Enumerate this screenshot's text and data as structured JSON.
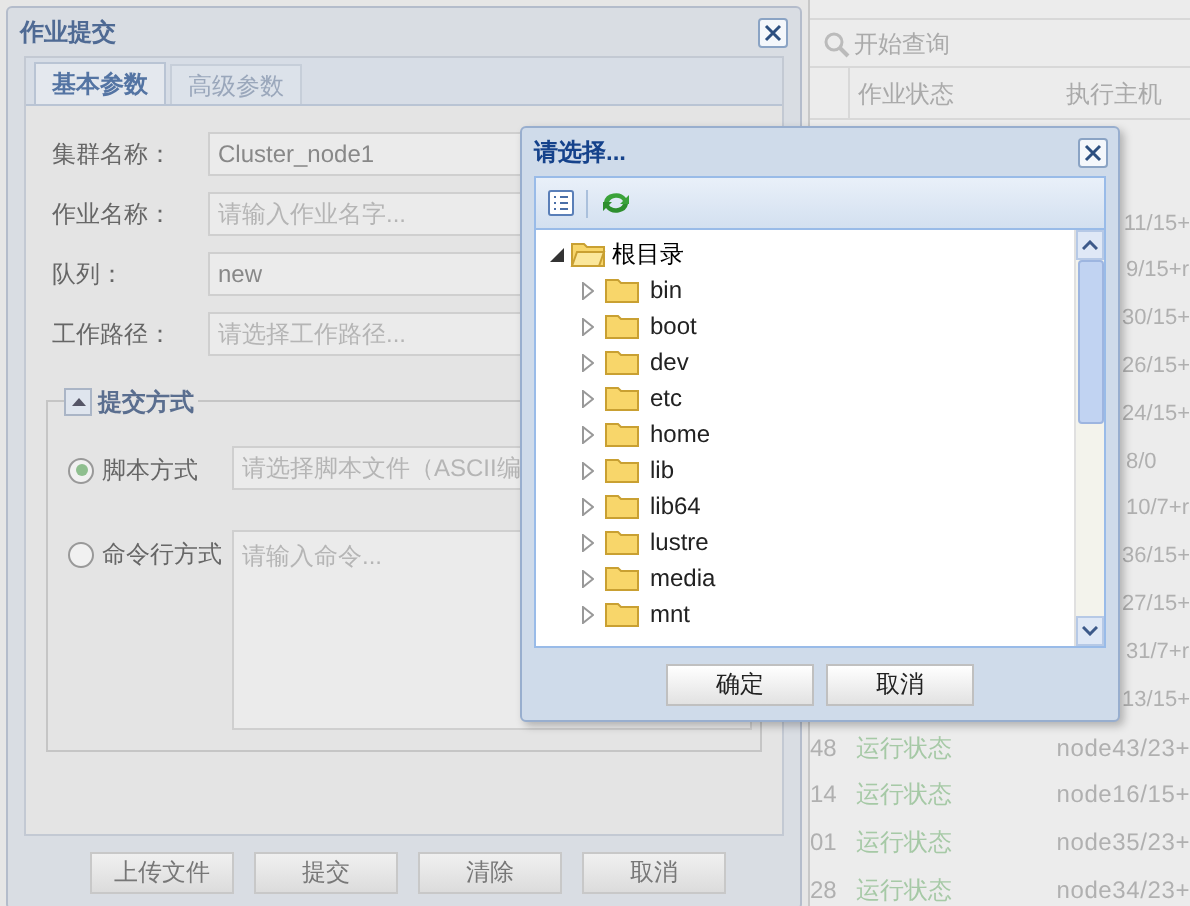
{
  "background_table": {
    "toolbar_button": "开始查询",
    "columns": [
      "作业状态",
      "执行主机"
    ],
    "rows": [
      {
        "host": "11/15+"
      },
      {
        "host": "9/15+r"
      },
      {
        "host": "30/15+"
      },
      {
        "host": "26/15+"
      },
      {
        "host": "24/15+"
      },
      {
        "host": "8/0"
      },
      {
        "host": "10/7+r"
      },
      {
        "host": "36/15+"
      },
      {
        "host": "27/15+"
      },
      {
        "host": "31/7+r"
      },
      {
        "host": "13/15+"
      },
      {
        "id": "48",
        "status": "运行状态",
        "host": "node43/23+"
      },
      {
        "id": "14",
        "status": "运行状态",
        "host": "node16/15+"
      },
      {
        "id": "01",
        "status": "运行状态",
        "host": "node35/23+"
      },
      {
        "id": "28",
        "status": "运行状态",
        "host": "node34/23+"
      }
    ]
  },
  "job_dialog": {
    "title": "作业提交",
    "tabs": [
      {
        "label": "基本参数",
        "selected": true
      },
      {
        "label": "高级参数",
        "selected": false
      }
    ],
    "fields": [
      {
        "label": "集群名称：",
        "value": "Cluster_node1"
      },
      {
        "label": "作业名称：",
        "placeholder": "请输入作业名字..."
      },
      {
        "label": "队列：",
        "value": "new"
      },
      {
        "label": "工作路径：",
        "placeholder": "请选择工作路径..."
      }
    ],
    "submit_section": {
      "title": "提交方式",
      "expanded": true,
      "options": [
        {
          "label": "脚本方式",
          "selected": true,
          "kind": "input",
          "placeholder": "请选择脚本文件（ASCII编"
        },
        {
          "label": "命令行方式",
          "selected": false,
          "kind": "textarea",
          "placeholder": "请输入命令..."
        }
      ]
    },
    "buttons": [
      "上传文件",
      "提交",
      "清除",
      "取消"
    ]
  },
  "picker": {
    "title": "请选择...",
    "tree": {
      "label": "根目录",
      "expanded": true,
      "children": [
        {
          "label": "bin",
          "expanded": false
        },
        {
          "label": "boot",
          "expanded": false
        },
        {
          "label": "dev",
          "expanded": false
        },
        {
          "label": "etc",
          "expanded": false
        },
        {
          "label": "home",
          "expanded": false
        },
        {
          "label": "lib",
          "expanded": false
        },
        {
          "label": "lib64",
          "expanded": false
        },
        {
          "label": "lustre",
          "expanded": false
        },
        {
          "label": "media",
          "expanded": false
        },
        {
          "label": "mnt",
          "expanded": false
        }
      ]
    },
    "buttons": [
      "确定",
      "取消"
    ]
  }
}
